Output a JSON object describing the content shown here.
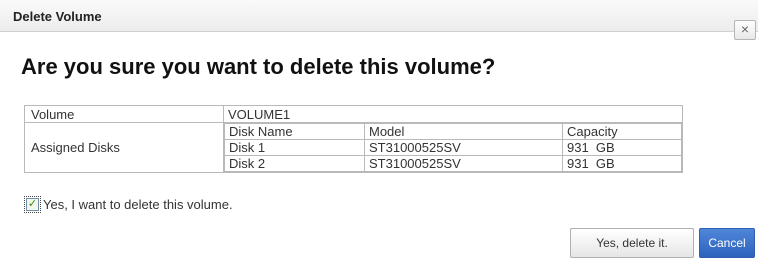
{
  "dialog": {
    "title": "Delete Volume",
    "close_icon_glyph": "×",
    "heading": "Are you sure you want to delete this volume?"
  },
  "info_table": {
    "volume_label": "Volume",
    "volume_value": "VOLUME1",
    "assigned_disks_label": "Assigned Disks",
    "disk_columns": [
      "Disk Name",
      "Model",
      "Capacity"
    ],
    "disks": [
      {
        "name": "Disk 1",
        "model": "ST31000525SV",
        "capacity": "931  GB"
      },
      {
        "name": "Disk 2",
        "model": "ST31000525SV",
        "capacity": "931  GB"
      }
    ]
  },
  "confirm": {
    "checked": true,
    "check_glyph": "✓",
    "label": "Yes, I want to delete this volume."
  },
  "buttons": {
    "confirm_label": "Yes, delete it.",
    "cancel_label": "Cancel"
  },
  "colors": {
    "cancel_button": "#2e63be",
    "checkbox_check": "#3a8a20"
  }
}
